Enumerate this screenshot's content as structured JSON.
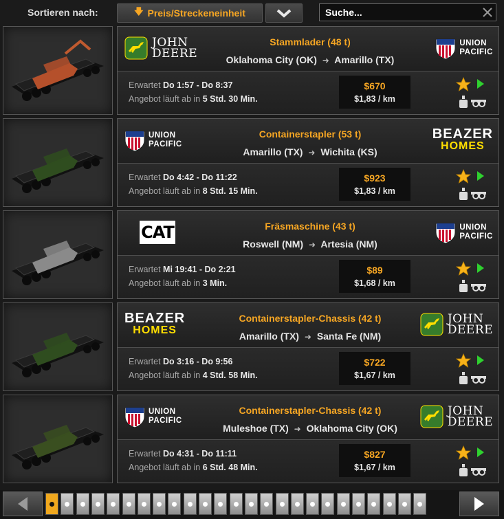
{
  "header": {
    "sort_label": "Sortieren nach:",
    "sort_value": "Preis/Streckeneinheit",
    "search_placeholder": "Suche..."
  },
  "jobs": [
    {
      "cargo": "Stammlader (48 t)",
      "from": "Oklahoma City (OK)",
      "to": "Amarillo (TX)",
      "expected_label": "Erwartet",
      "expected": "Do 1:57 - Do 8:37",
      "offer_label": "Angebot läuft ab in",
      "offer": "5 Std. 30 Min.",
      "price": "$670",
      "per_km": "$1,83 / km",
      "logo_left": {
        "name": "john-deere",
        "line1": "JOHN",
        "line2": "DEERE"
      },
      "logo_right": {
        "name": "union-pacific",
        "line1": "UNION",
        "line2": "PACIFIC"
      }
    },
    {
      "cargo": "Containerstapler (53 t)",
      "from": "Amarillo (TX)",
      "to": "Wichita (KS)",
      "expected_label": "Erwartet",
      "expected": "Do 4:42 - Do 11:22",
      "offer_label": "Angebot läuft ab in",
      "offer": "8 Std. 15 Min.",
      "price": "$923",
      "per_km": "$1,83 / km",
      "logo_left": {
        "name": "union-pacific",
        "line1": "UNION",
        "line2": "PACIFIC"
      },
      "logo_right": {
        "name": "beazer-homes",
        "line1": "BEAZER",
        "line2": "HOMES"
      }
    },
    {
      "cargo": "Fräsmaschine (43 t)",
      "from": "Roswell (NM)",
      "to": "Artesia (NM)",
      "expected_label": "Erwartet",
      "expected": "Mi 19:41 - Do 2:21",
      "offer_label": "Angebot läuft ab in",
      "offer": "3 Min.",
      "price": "$89",
      "per_km": "$1,68 / km",
      "logo_left": {
        "name": "cat",
        "line1": "CAT",
        "line2": ""
      },
      "logo_right": {
        "name": "union-pacific",
        "line1": "UNION",
        "line2": "PACIFIC"
      }
    },
    {
      "cargo": "Containerstapler-Chassis (42 t)",
      "from": "Amarillo (TX)",
      "to": "Santa Fe (NM)",
      "expected_label": "Erwartet",
      "expected": "Do 3:16 - Do 9:56",
      "offer_label": "Angebot läuft ab in",
      "offer": "4 Std. 58 Min.",
      "price": "$722",
      "per_km": "$1,67 / km",
      "logo_left": {
        "name": "beazer-homes",
        "line1": "BEAZER",
        "line2": "HOMES"
      },
      "logo_right": {
        "name": "john-deere",
        "line1": "JOHN",
        "line2": "DEERE"
      }
    },
    {
      "cargo": "Containerstapler-Chassis (42 t)",
      "from": "Muleshoe (TX)",
      "to": "Oklahoma City (OK)",
      "expected_label": "Erwartet",
      "expected": "Do 4:31 - Do 11:11",
      "offer_label": "Angebot läuft ab in",
      "offer": "6 Std. 48 Min.",
      "price": "$827",
      "per_km": "$1,67 / km",
      "logo_left": {
        "name": "union-pacific",
        "line1": "UNION",
        "line2": "PACIFIC"
      },
      "logo_right": {
        "name": "john-deere",
        "line1": "JOHN",
        "line2": "DEERE"
      }
    }
  ],
  "pager": {
    "total_pages": 25,
    "current_page": 1
  },
  "colors": {
    "accent": "#f6a623",
    "deere_green": "#367c2b",
    "deere_yellow": "#ffde00",
    "up_red": "#c8102e",
    "up_blue": "#1d3f8f",
    "play_green": "#2fd12f"
  }
}
